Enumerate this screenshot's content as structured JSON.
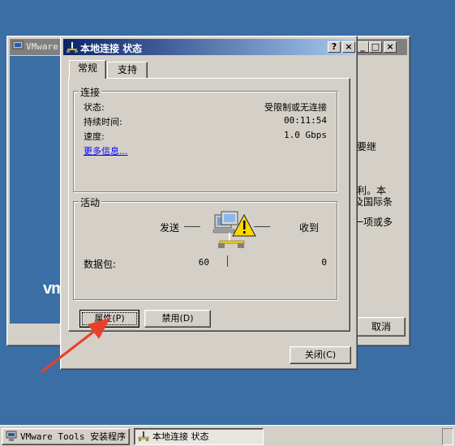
{
  "background_window": {
    "title": "VMware",
    "logo": "vm",
    "text_lines": [
      "要继",
      "利。本",
      "及国际条",
      "一项或多"
    ],
    "cancel_label": "取消"
  },
  "dialog": {
    "title": "本地连接 状态",
    "help_button": "?",
    "close_glyph": "×",
    "tabs": [
      {
        "label": "常规",
        "selected": true
      },
      {
        "label": "支持",
        "selected": false
      }
    ],
    "connection": {
      "group_label": "连接",
      "status_label": "状态:",
      "status_value": "受限制或无连接",
      "duration_label": "持续时间:",
      "duration_value": "00:11:54",
      "speed_label": "速度:",
      "speed_value": "1.0 Gbps",
      "more_info_link": "更多信息..."
    },
    "activity": {
      "group_label": "活动",
      "sent_label": "发送",
      "received_label": "收到",
      "packets_label": "数据包:",
      "packets_sent": "60",
      "packets_received": "0",
      "icon": "network-warning-icon"
    },
    "buttons": {
      "properties": "属性(P)",
      "disable": "禁用(D)",
      "close": "关闭(C)"
    }
  },
  "taskbar": {
    "items": [
      {
        "label": "VMware Tools 安装程序",
        "active": false
      },
      {
        "label": "本地连接 状态",
        "active": true
      }
    ]
  },
  "colors": {
    "desktop": "#3a6ea5",
    "title_active_start": "#0a246a",
    "title_active_end": "#a6caf0",
    "title_inactive": "#808080",
    "face": "#d4d0c8",
    "link": "#0000ff",
    "annotation_arrow": "#e8402a",
    "warning": "#ffd700"
  }
}
